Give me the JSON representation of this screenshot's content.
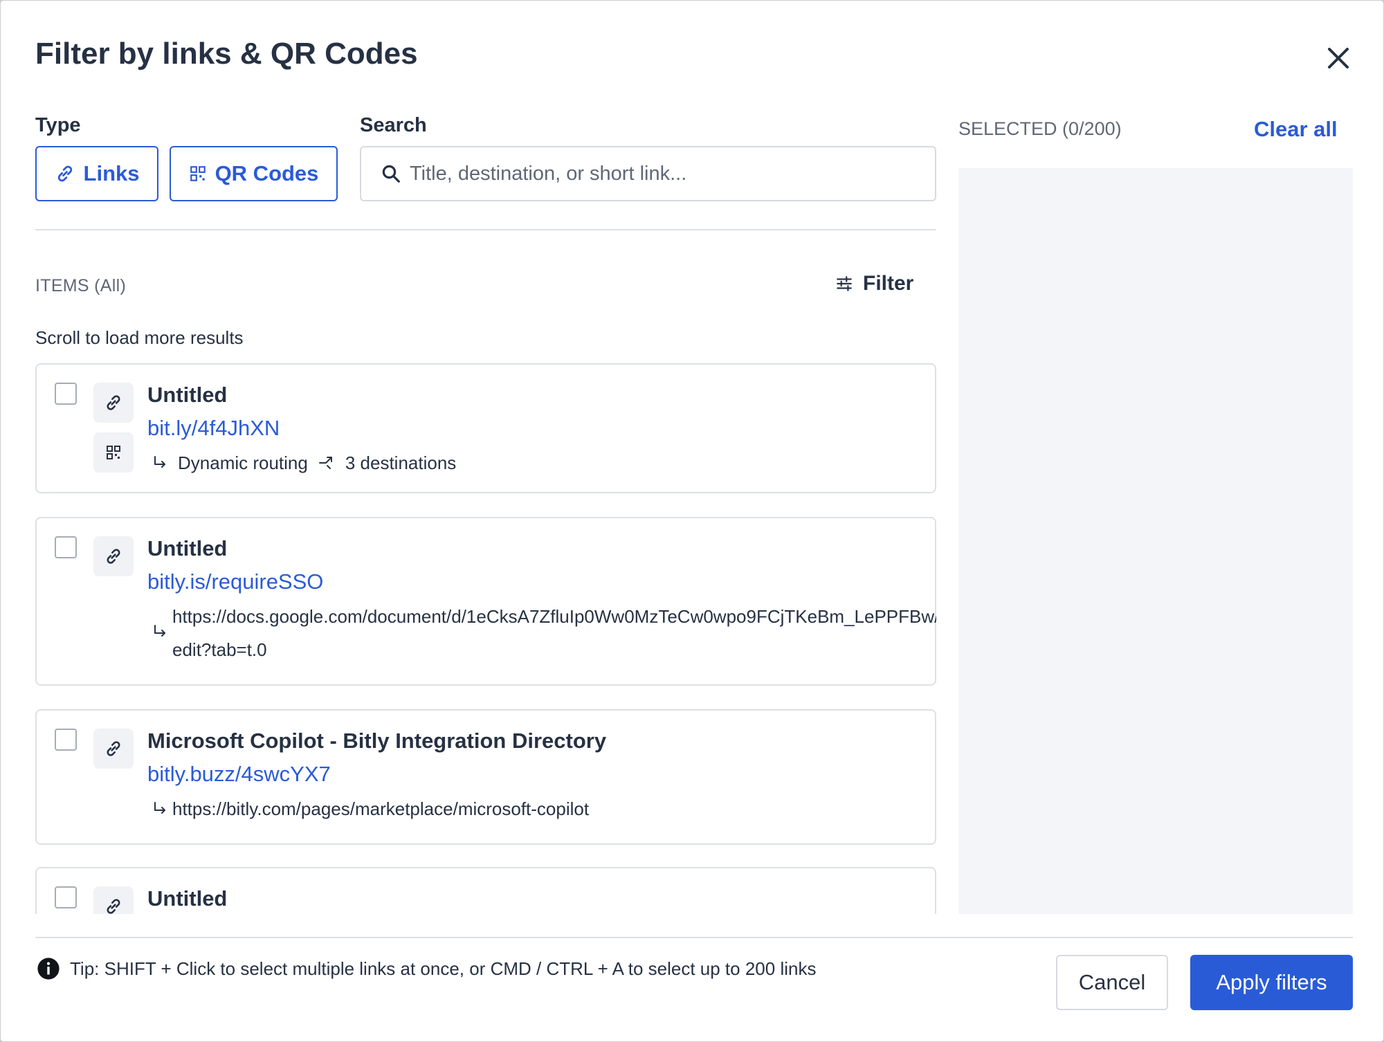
{
  "modal": {
    "title": "Filter by links & QR Codes"
  },
  "type": {
    "label": "Type",
    "links_label": "Links",
    "qr_label": "QR Codes"
  },
  "search": {
    "label": "Search",
    "placeholder": "Title, destination, or short link...",
    "value": ""
  },
  "items": {
    "header": "ITEMS (All)",
    "filter_label": "Filter",
    "scroll_message": "Scroll to load more results",
    "list": [
      {
        "title": "Untitled",
        "short_link": "bit.ly/4f4JhXN",
        "has_qr": true,
        "routing_label": "Dynamic routing",
        "destinations_label": "3 destinations"
      },
      {
        "title": "Untitled",
        "short_link": "bitly.is/requireSSO",
        "destination": "https://docs.google.com/document/d/1eCksA7ZfluIp0Ww0MzTeCw0wpo9FCjTKeBm_LePPFBw/edit?tab=t.0"
      },
      {
        "title": "Microsoft Copilot - Bitly Integration Directory",
        "short_link": "bitly.buzz/4swcYX7",
        "destination": "https://bitly.com/pages/marketplace/microsoft-copilot"
      },
      {
        "title": "Untitled"
      }
    ]
  },
  "selected": {
    "header": "SELECTED (0/200)",
    "clear_label": "Clear all"
  },
  "footer": {
    "tip": "Tip: SHIFT + Click to select multiple links at once, or CMD / CTRL + A to select up to 200 links",
    "cancel_label": "Cancel",
    "apply_label": "Apply filters"
  },
  "icons": {
    "close": "close-icon",
    "link": "link-icon",
    "qr": "qr-code-icon",
    "search": "search-icon",
    "filter": "sliders-icon",
    "info": "info-icon",
    "arrow": "return-arrow-icon",
    "routing": "routing-icon"
  },
  "colors": {
    "accent": "#2a5bd7",
    "text": "#273144",
    "muted": "#5f6776",
    "panel": "#f3f5f8",
    "border": "#dde0e5"
  }
}
